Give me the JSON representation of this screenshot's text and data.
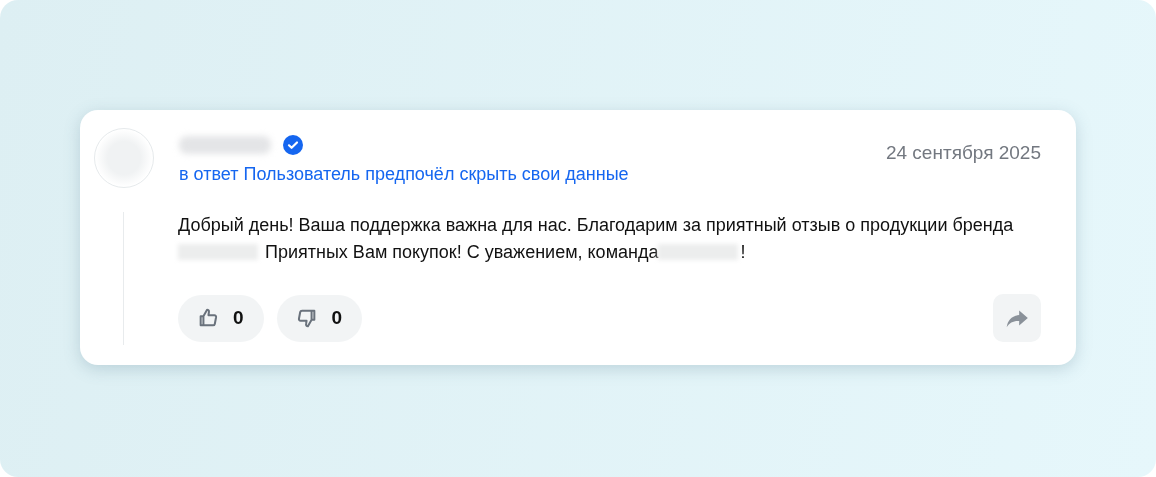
{
  "comment": {
    "author": {
      "verified": true
    },
    "reply_to": "в ответ Пользователь предпочёл скрыть свои данные",
    "date": "24 сентября 2025",
    "message_parts": [
      {
        "kind": "text",
        "text": "Добрый день! Ваша поддержка важна для нас. Благодарим за приятный отзыв о продукции бренда"
      },
      {
        "kind": "redacted"
      },
      {
        "kind": "text",
        "text": "Приятных Вам покупок! С уважением, команда"
      },
      {
        "kind": "redacted"
      },
      {
        "kind": "text",
        "text": "!"
      }
    ],
    "reactions": [
      {
        "kind": "like",
        "count": "0"
      },
      {
        "kind": "dislike",
        "count": "0"
      }
    ]
  }
}
